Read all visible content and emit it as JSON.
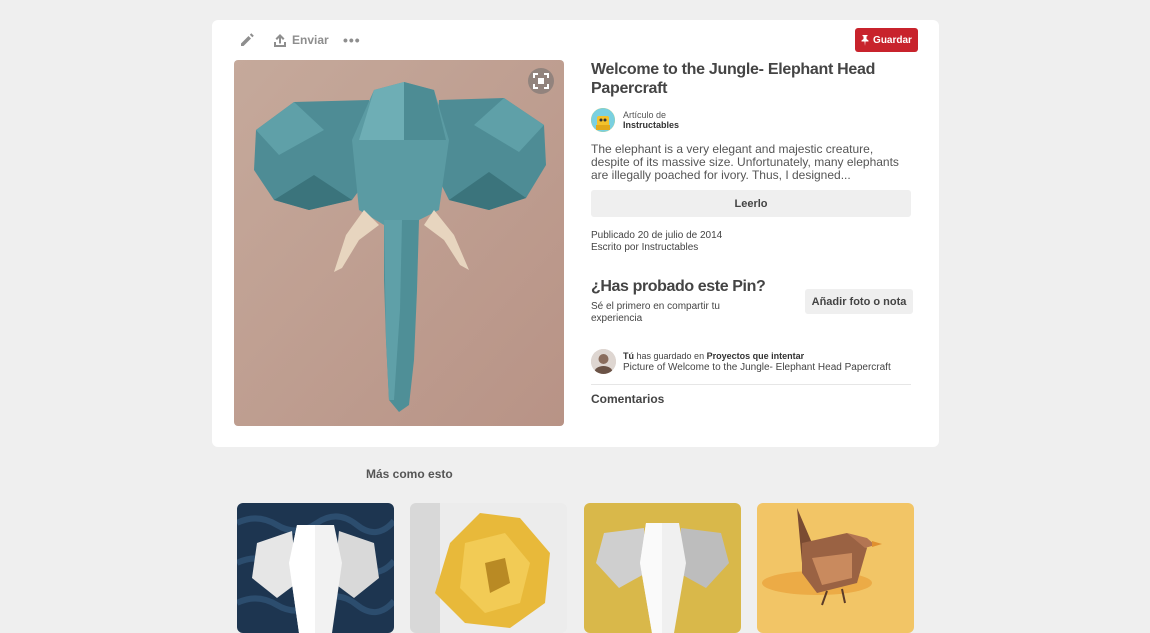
{
  "toolbar": {
    "send_label": "Enviar",
    "more_label": "•••",
    "save_label": "Guardar",
    "accent": "#c8232c"
  },
  "pin": {
    "title": "Welcome to the Jungle- Elephant Head Papercraft",
    "source_prefix": "Artículo de",
    "source_name": "Instructables",
    "description": "The elephant is a very elegant and majestic creature, despite of its massive size. Unfortunately, many elephants are illegally poached for ivory. Thus, I designed...",
    "read_label": "Leerlo",
    "published": "Publicado 20 de julio de 2014",
    "author": "Escrito por Instructables"
  },
  "tried": {
    "title": "¿Has probado este Pin?",
    "subtitle": "Sé el primero en compartir tu experiencia",
    "button_label": "Añadir foto o nota"
  },
  "saved": {
    "user": "Tú",
    "middle": "has guardado en",
    "board": "Proyectos que intentar",
    "caption": "Picture of Welcome to the Jungle- Elephant Head Papercraft"
  },
  "comments_label": "Comentarios",
  "more_like_this": "Más como esto",
  "thumbnails": [
    {
      "name": "white-elephant-papercraft"
    },
    {
      "name": "lion-papercraft"
    },
    {
      "name": "white-elephant-on-yellow"
    },
    {
      "name": "bird-papercraft"
    }
  ]
}
